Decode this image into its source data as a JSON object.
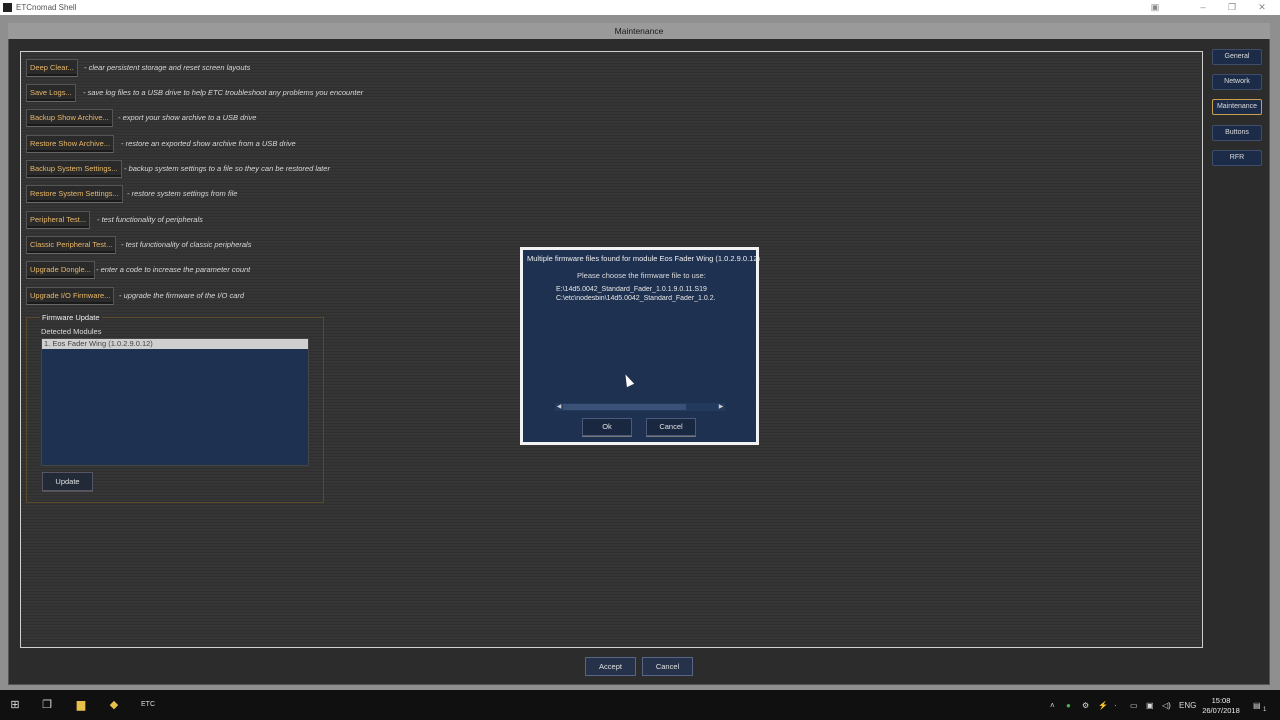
{
  "titlebar": {
    "title": "ETCnomad Shell"
  },
  "header": {
    "title": "Maintenance"
  },
  "maintenance_items": [
    {
      "label": "Deep Clear...",
      "desc": "- clear persistent storage and reset screen layouts"
    },
    {
      "label": "Save Logs...",
      "desc": "- save log files to a USB drive to help ETC troubleshoot any problems you encounter"
    },
    {
      "label": "Backup Show Archive...",
      "desc": "- export your show archive to a USB drive"
    },
    {
      "label": "Restore Show Archive...",
      "desc": "- restore an exported show archive from a USB drive"
    },
    {
      "label": "Backup System Settings...",
      "desc": "- backup system settings to a file so they can be restored later"
    },
    {
      "label": "Restore System Settings...",
      "desc": "- restore system settings from file"
    },
    {
      "label": "Peripheral Test...",
      "desc": "- test functionality of peripherals"
    },
    {
      "label": "Classic Peripheral Test...",
      "desc": "- test functionality of classic peripherals"
    },
    {
      "label": "Upgrade Dongle...",
      "desc": "- enter a code to increase the parameter count"
    },
    {
      "label": "Upgrade I/O Firmware...",
      "desc": "- upgrade the firmware of the I/O card"
    }
  ],
  "firmware_update": {
    "title": "Firmware Update",
    "detected_label": "Detected Modules",
    "modules": [
      "1. Eos Fader Wing (1.0.2.9.0.12)"
    ],
    "update_label": "Update"
  },
  "sidebar": {
    "items": [
      {
        "label": "General"
      },
      {
        "label": "Network"
      },
      {
        "label": "Maintenance"
      },
      {
        "label": "Buttons"
      },
      {
        "label": "RFR"
      }
    ]
  },
  "dialog": {
    "title": "Multiple firmware files found for module Eos Fader Wing (1.0.2.9.0.12)",
    "prompt": "Please choose the firmware file to use:",
    "files": [
      "E:\\14d5.0042_Standard_Fader_1.0.1.9.0.11.S19",
      "C:\\etc\\nodesbin\\14d5.0042_Standard_Fader_1.0.2."
    ],
    "ok_label": "Ok",
    "cancel_label": "Cancel"
  },
  "footer": {
    "accept_label": "Accept",
    "cancel_label": "Cancel"
  },
  "taskbar": {
    "app_label": "ETC",
    "language": "ENG",
    "time": "15:08",
    "date": "26/07/2018",
    "notification_count": "1"
  }
}
